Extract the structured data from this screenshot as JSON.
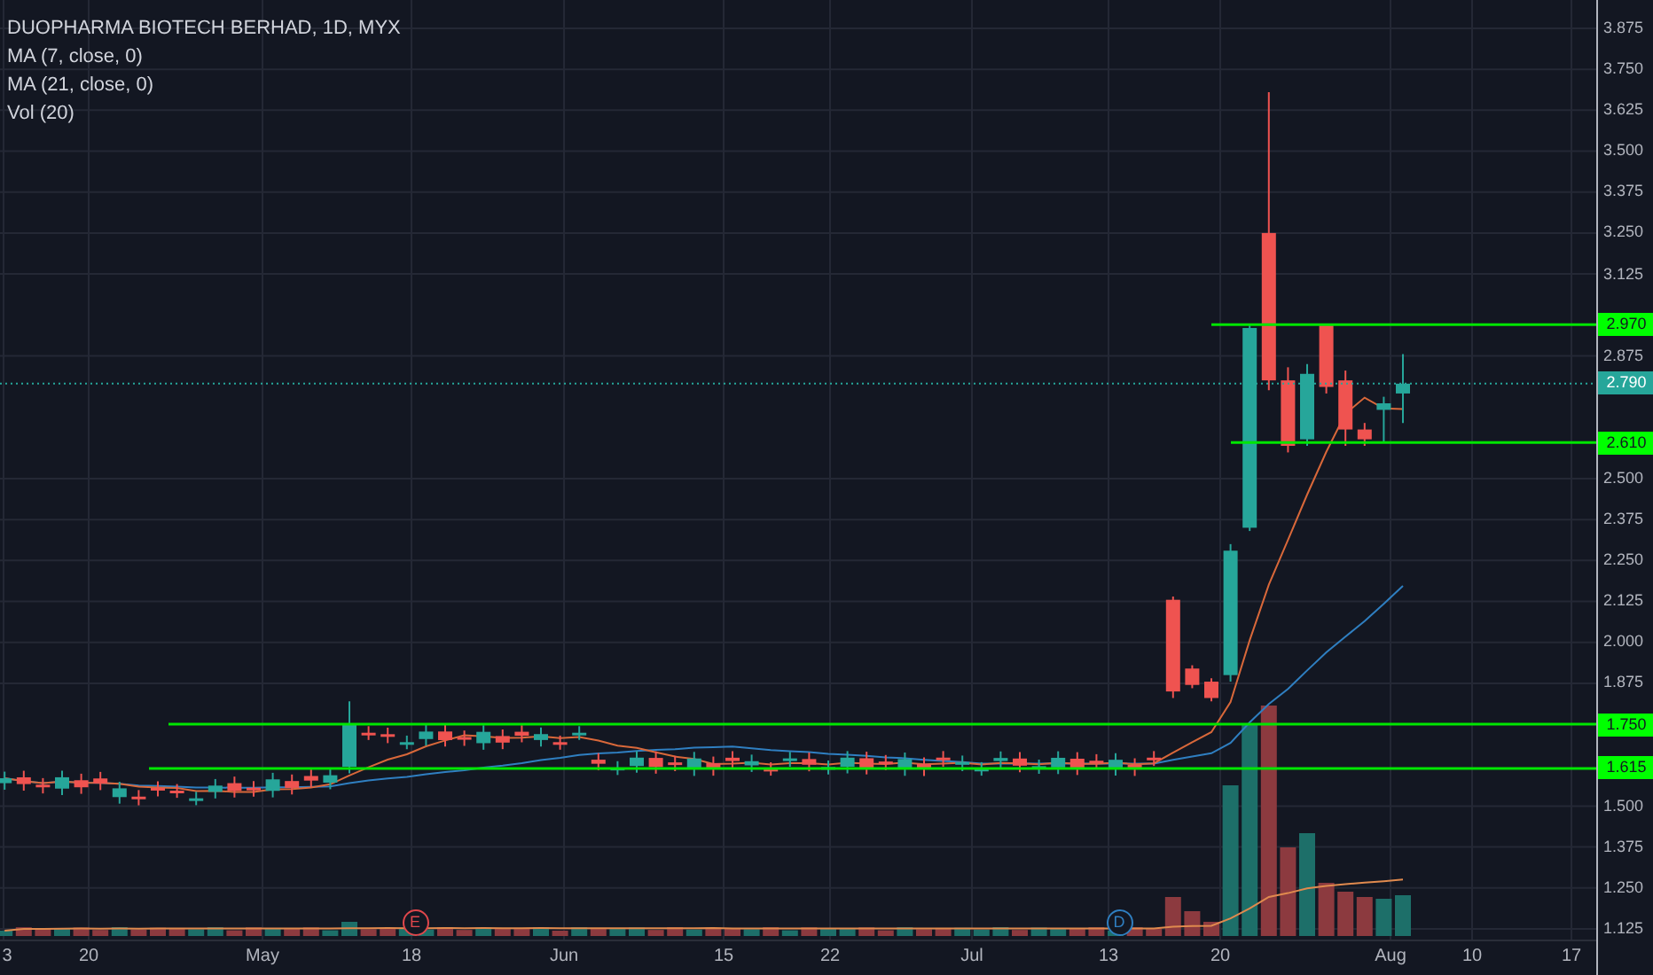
{
  "legend": {
    "title": "DUOPHARMA BIOTECH BERHAD, 1D, MYX",
    "indicators": [
      "MA (7, close, 0)",
      "MA (21, close, 0)",
      "Vol (20)"
    ]
  },
  "price_axis": {
    "ticks": [
      "3.875",
      "3.750",
      "3.625",
      "3.500",
      "3.375",
      "3.250",
      "3.125",
      "2.875",
      "2.500",
      "2.375",
      "2.250",
      "2.125",
      "2.000",
      "1.875",
      "1.500",
      "1.375",
      "1.250",
      "1.125"
    ]
  },
  "price_tags": [
    {
      "label": "2.970",
      "kind": "level"
    },
    {
      "label": "2.790",
      "kind": "last"
    },
    {
      "label": "2.610",
      "kind": "level"
    },
    {
      "label": "1.750",
      "kind": "level"
    },
    {
      "label": "1.615",
      "kind": "level"
    }
  ],
  "events": [
    {
      "label": "E",
      "color": "#e0474c"
    },
    {
      "label": "D",
      "color": "#2f7fc1"
    }
  ],
  "time_axis": {
    "ticks": [
      "3",
      "20",
      "May",
      "18",
      "Jun",
      "15",
      "22",
      "Jul",
      "13",
      "20",
      "Aug",
      "10",
      "17"
    ]
  }
}
